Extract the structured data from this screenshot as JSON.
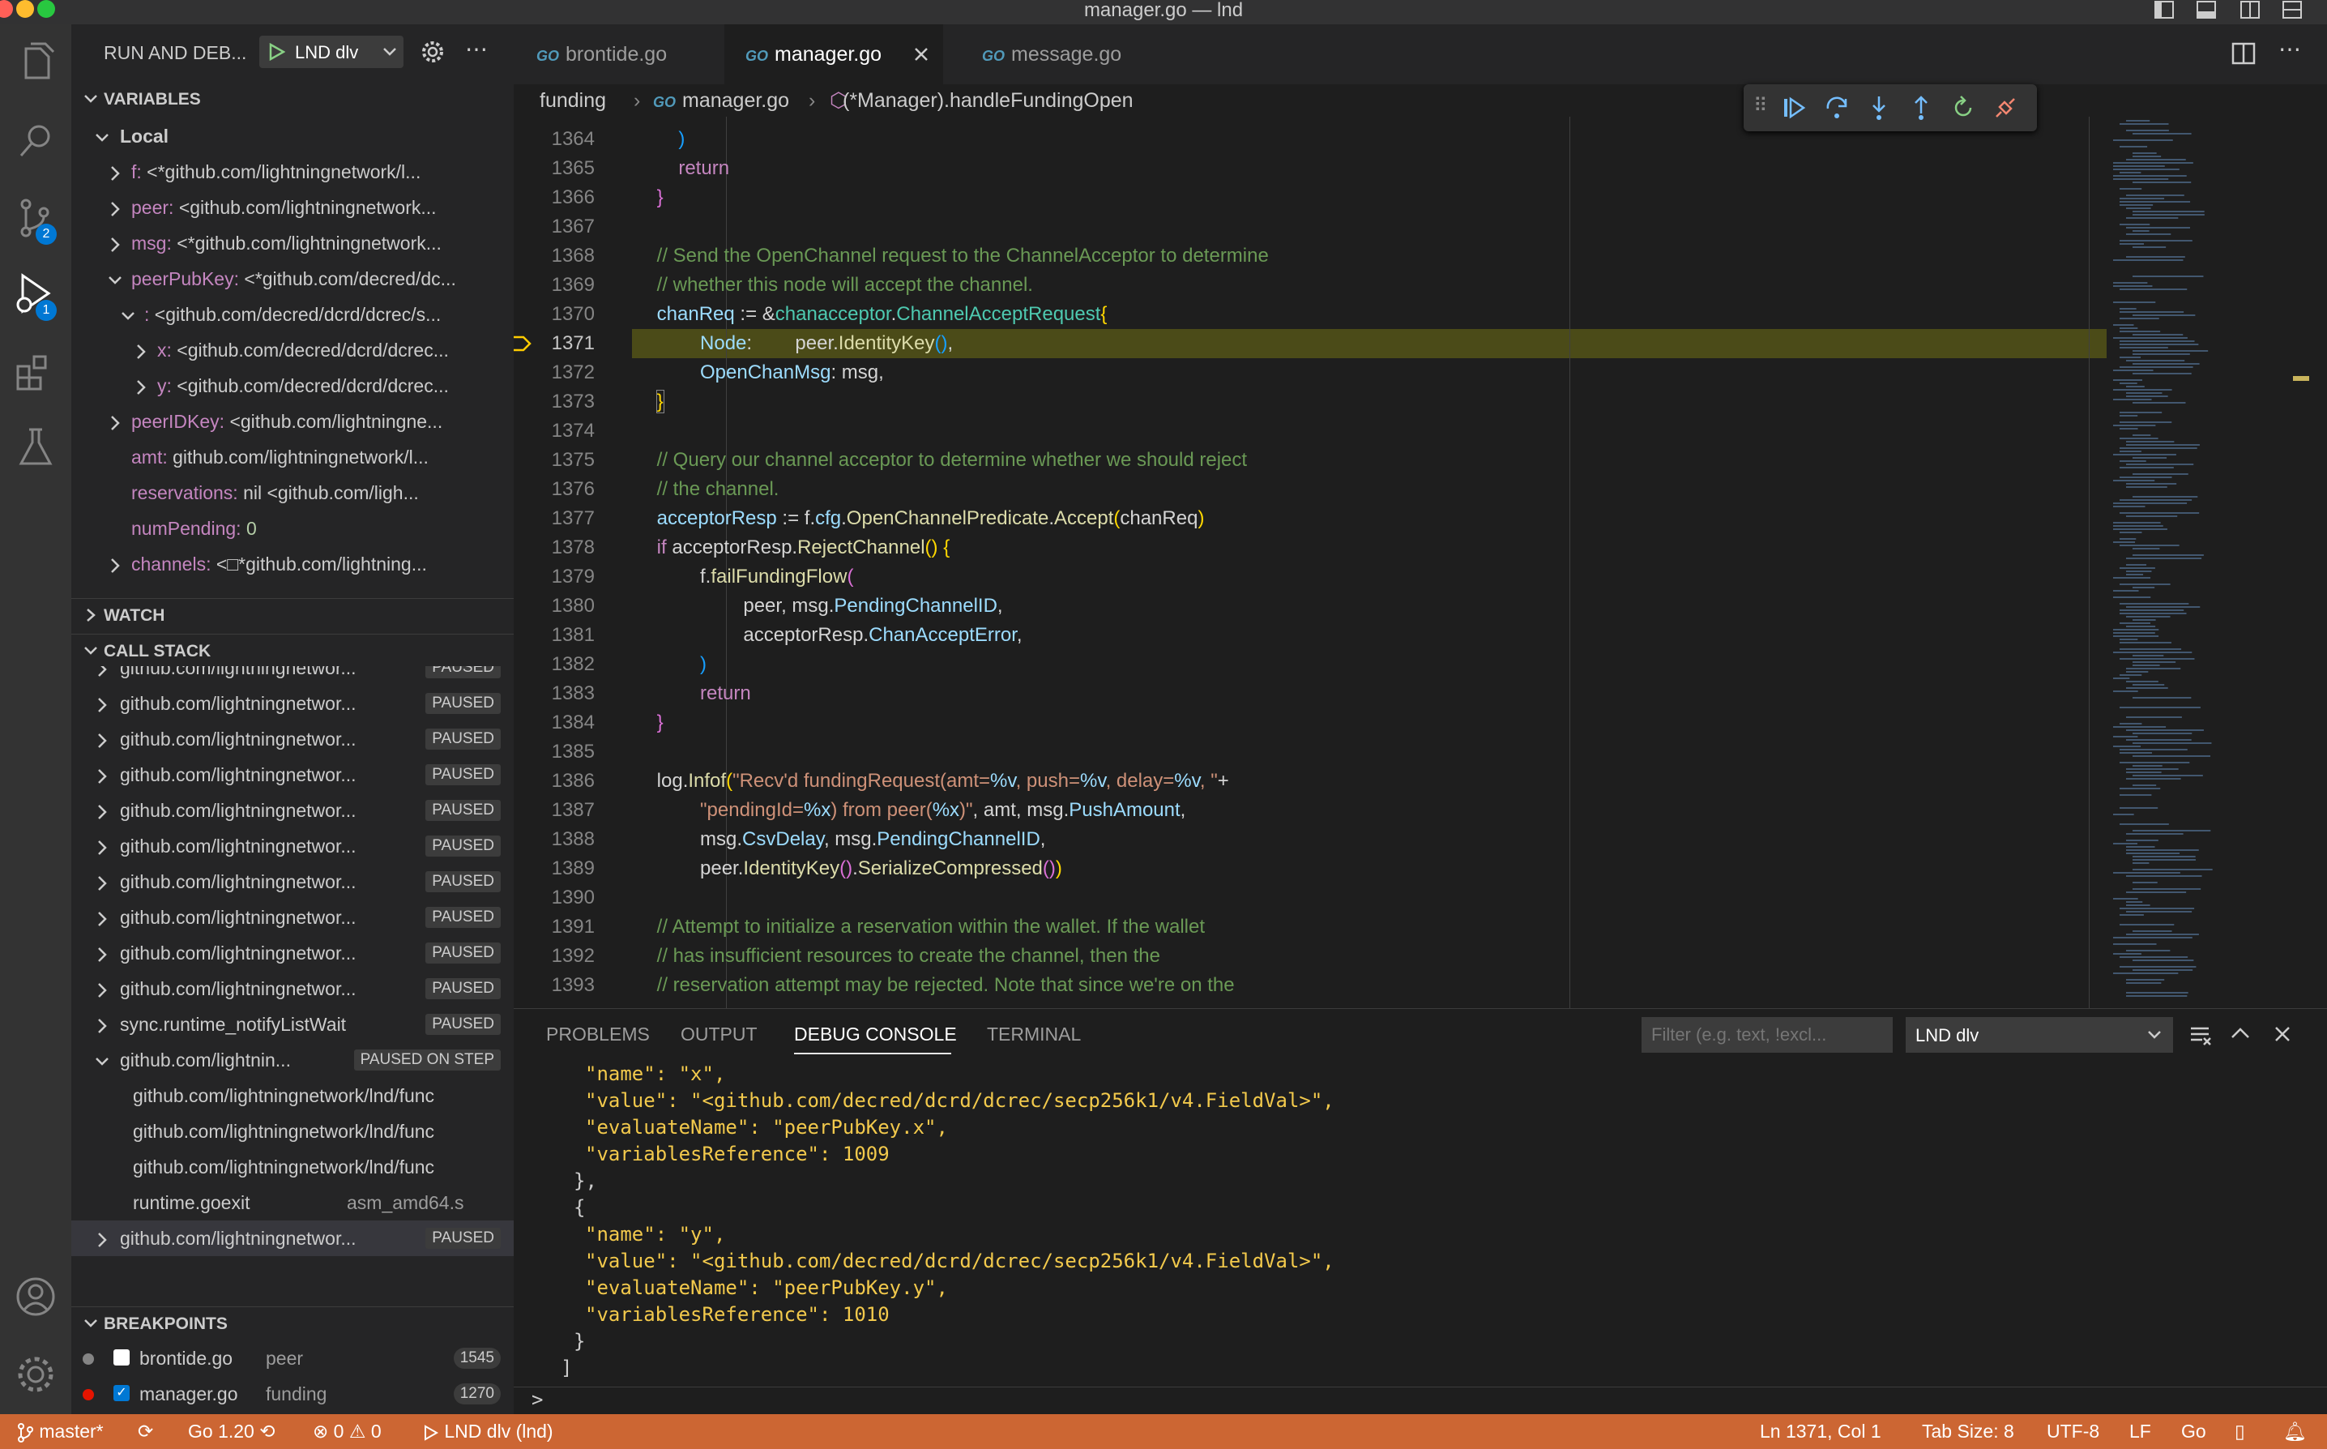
{
  "window": {
    "title": "manager.go — lnd"
  },
  "activity_bar": {
    "scm_badge": "2",
    "debug_badge": "1"
  },
  "run_debug": {
    "title": "RUN AND DEB...",
    "config": "LND dlv"
  },
  "variables": {
    "header": "VARIABLES",
    "scope": "Local",
    "items": [
      {
        "key": "f:",
        "value": "<*github.com/lightningnetwork/l..."
      },
      {
        "key": "peer:",
        "value": "<github.com/lightningnetwork..."
      },
      {
        "key": "msg:",
        "value": "<*github.com/lightningnetwork..."
      },
      {
        "key": "peerPubKey:",
        "value": "<*github.com/decred/dc..."
      },
      {
        "key": ":",
        "value": "<github.com/decred/dcrd/dcrec/s..."
      },
      {
        "key": "x:",
        "value": "<github.com/decred/dcrd/dcrec..."
      },
      {
        "key": "y:",
        "value": "<github.com/decred/dcrd/dcrec..."
      },
      {
        "key": "peerIDKey:",
        "value": "<github.com/lightningne..."
      },
      {
        "key": "amt:",
        "value": "github.com/lightningnetwork/l..."
      },
      {
        "key": "reservations:",
        "value": "nil <github.com/ligh..."
      },
      {
        "key": "numPending:",
        "value": "0"
      },
      {
        "key": "channels:",
        "value": "<□*github.com/lightning..."
      }
    ]
  },
  "watch": {
    "header": "WATCH"
  },
  "call_stack": {
    "header": "CALL STACK",
    "paused": "PAUSED",
    "paused_on_step": "PAUSED ON STEP",
    "frame_label": "github.com/lightningnetwor...",
    "notify": "sync.runtime_notifyListWait",
    "step_thread": "github.com/lightnin...",
    "sub_frames": [
      "github.com/lightningnetwork/lnd/func",
      "github.com/lightningnetwork/lnd/func",
      "github.com/lightningnetwork/lnd/func"
    ],
    "goexit": "runtime.goexit",
    "goexit_file": "asm_amd64.s"
  },
  "breakpoints": {
    "header": "BREAKPOINTS",
    "items": [
      {
        "file": "brontide.go",
        "func": "peer",
        "line": "1545"
      },
      {
        "file": "manager.go",
        "func": "funding",
        "line": "1270"
      }
    ]
  },
  "tabs": [
    {
      "label": "brontide.go"
    },
    {
      "label": "manager.go"
    },
    {
      "label": "message.go"
    }
  ],
  "breadcrumb": {
    "dir": "funding",
    "file": "manager.go",
    "symbol": "(*Manager).handleFundingOpen"
  },
  "editor": {
    "line_numbers": [
      "1364",
      "1365",
      "1366",
      "1367",
      "1368",
      "1369",
      "1370",
      "1371",
      "1372",
      "1373",
      "1374",
      "1375",
      "1376",
      "1377",
      "1378",
      "1379",
      "1380",
      "1381",
      "1382",
      "1383",
      "1384",
      "1385",
      "1386",
      "1387",
      "1388",
      "1389",
      "1390",
      "1391",
      "1392",
      "1393"
    ],
    "current_line": "1371"
  },
  "panel": {
    "tabs": [
      "PROBLEMS",
      "OUTPUT",
      "DEBUG CONSOLE",
      "TERMINAL"
    ],
    "filter_placeholder": "Filter (e.g. text, !excl...",
    "session": "LND dlv",
    "output": [
      "\"name\": \"x\",",
      "\"value\": \"<github.com/decred/dcrd/dcrec/secp256k1/v4.FieldVal>\",",
      "\"evaluateName\": \"peerPubKey.x\",",
      "\"variablesReference\": 1009",
      "},",
      "{",
      "\"name\": \"y\",",
      "\"value\": \"<github.com/decred/dcrd/dcrec/secp256k1/v4.FieldVal>\",",
      "\"evaluateName\": \"peerPubKey.y\",",
      "\"variablesReference\": 1010",
      "}",
      "]"
    ],
    "prompt": ">"
  },
  "status_bar": {
    "branch": "master*",
    "go_version": "Go 1.20",
    "errors": "0",
    "warnings": "0",
    "debug": "LND dlv (lnd)",
    "position": "Ln 1371, Col 1",
    "tab_size": "Tab Size: 8",
    "encoding": "UTF-8",
    "eol": "LF",
    "language": "Go"
  }
}
